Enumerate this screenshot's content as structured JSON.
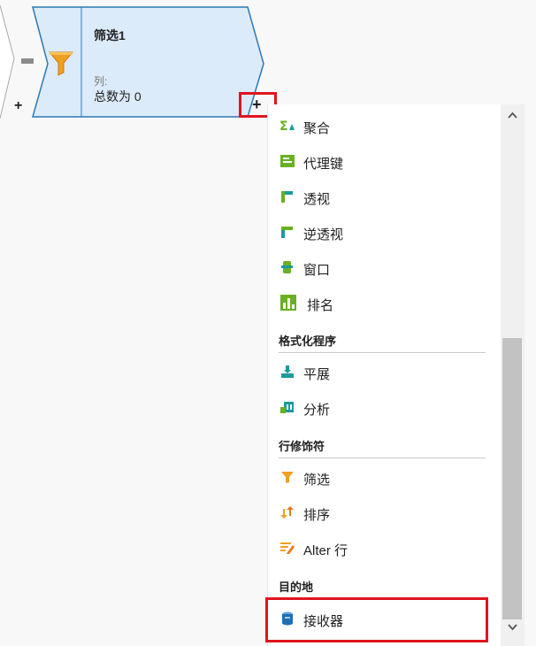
{
  "canvas": {
    "prev_node_add": "+"
  },
  "filter_node": {
    "title": "筛选1",
    "columns_label": "列:",
    "columns_value": "总数为 0",
    "add_button": "+"
  },
  "menu": {
    "items_top": [
      {
        "label": "聚合",
        "icon": "sigma-aggregate-icon"
      },
      {
        "label": "代理键",
        "icon": "surrogate-key-icon"
      },
      {
        "label": "透视",
        "icon": "pivot-icon"
      },
      {
        "label": "逆透视",
        "icon": "unpivot-icon"
      },
      {
        "label": "窗口",
        "icon": "window-icon"
      },
      {
        "label": "排名",
        "icon": "rank-icon"
      }
    ],
    "section_formatters": {
      "heading": "格式化程序",
      "items": [
        {
          "label": "平展",
          "icon": "flatten-icon"
        },
        {
          "label": "分析",
          "icon": "parse-icon"
        }
      ]
    },
    "section_row_modifiers": {
      "heading": "行修饰符",
      "items": [
        {
          "label": "筛选",
          "icon": "filter-icon"
        },
        {
          "label": "排序",
          "icon": "sort-icon"
        },
        {
          "label": "Alter 行",
          "icon": "alter-row-icon"
        }
      ]
    },
    "section_destination": {
      "heading": "目的地",
      "items": [
        {
          "label": "接收器",
          "icon": "sink-icon"
        }
      ]
    },
    "scroll_up": "^",
    "scroll_down": "v"
  },
  "colors": {
    "node_fill": "#dcebfa",
    "node_border": "#2b79b5",
    "highlight": "#e0141e",
    "filter_orange": "#f0a020",
    "teal": "#1a9aa0",
    "green": "#6ab023"
  }
}
